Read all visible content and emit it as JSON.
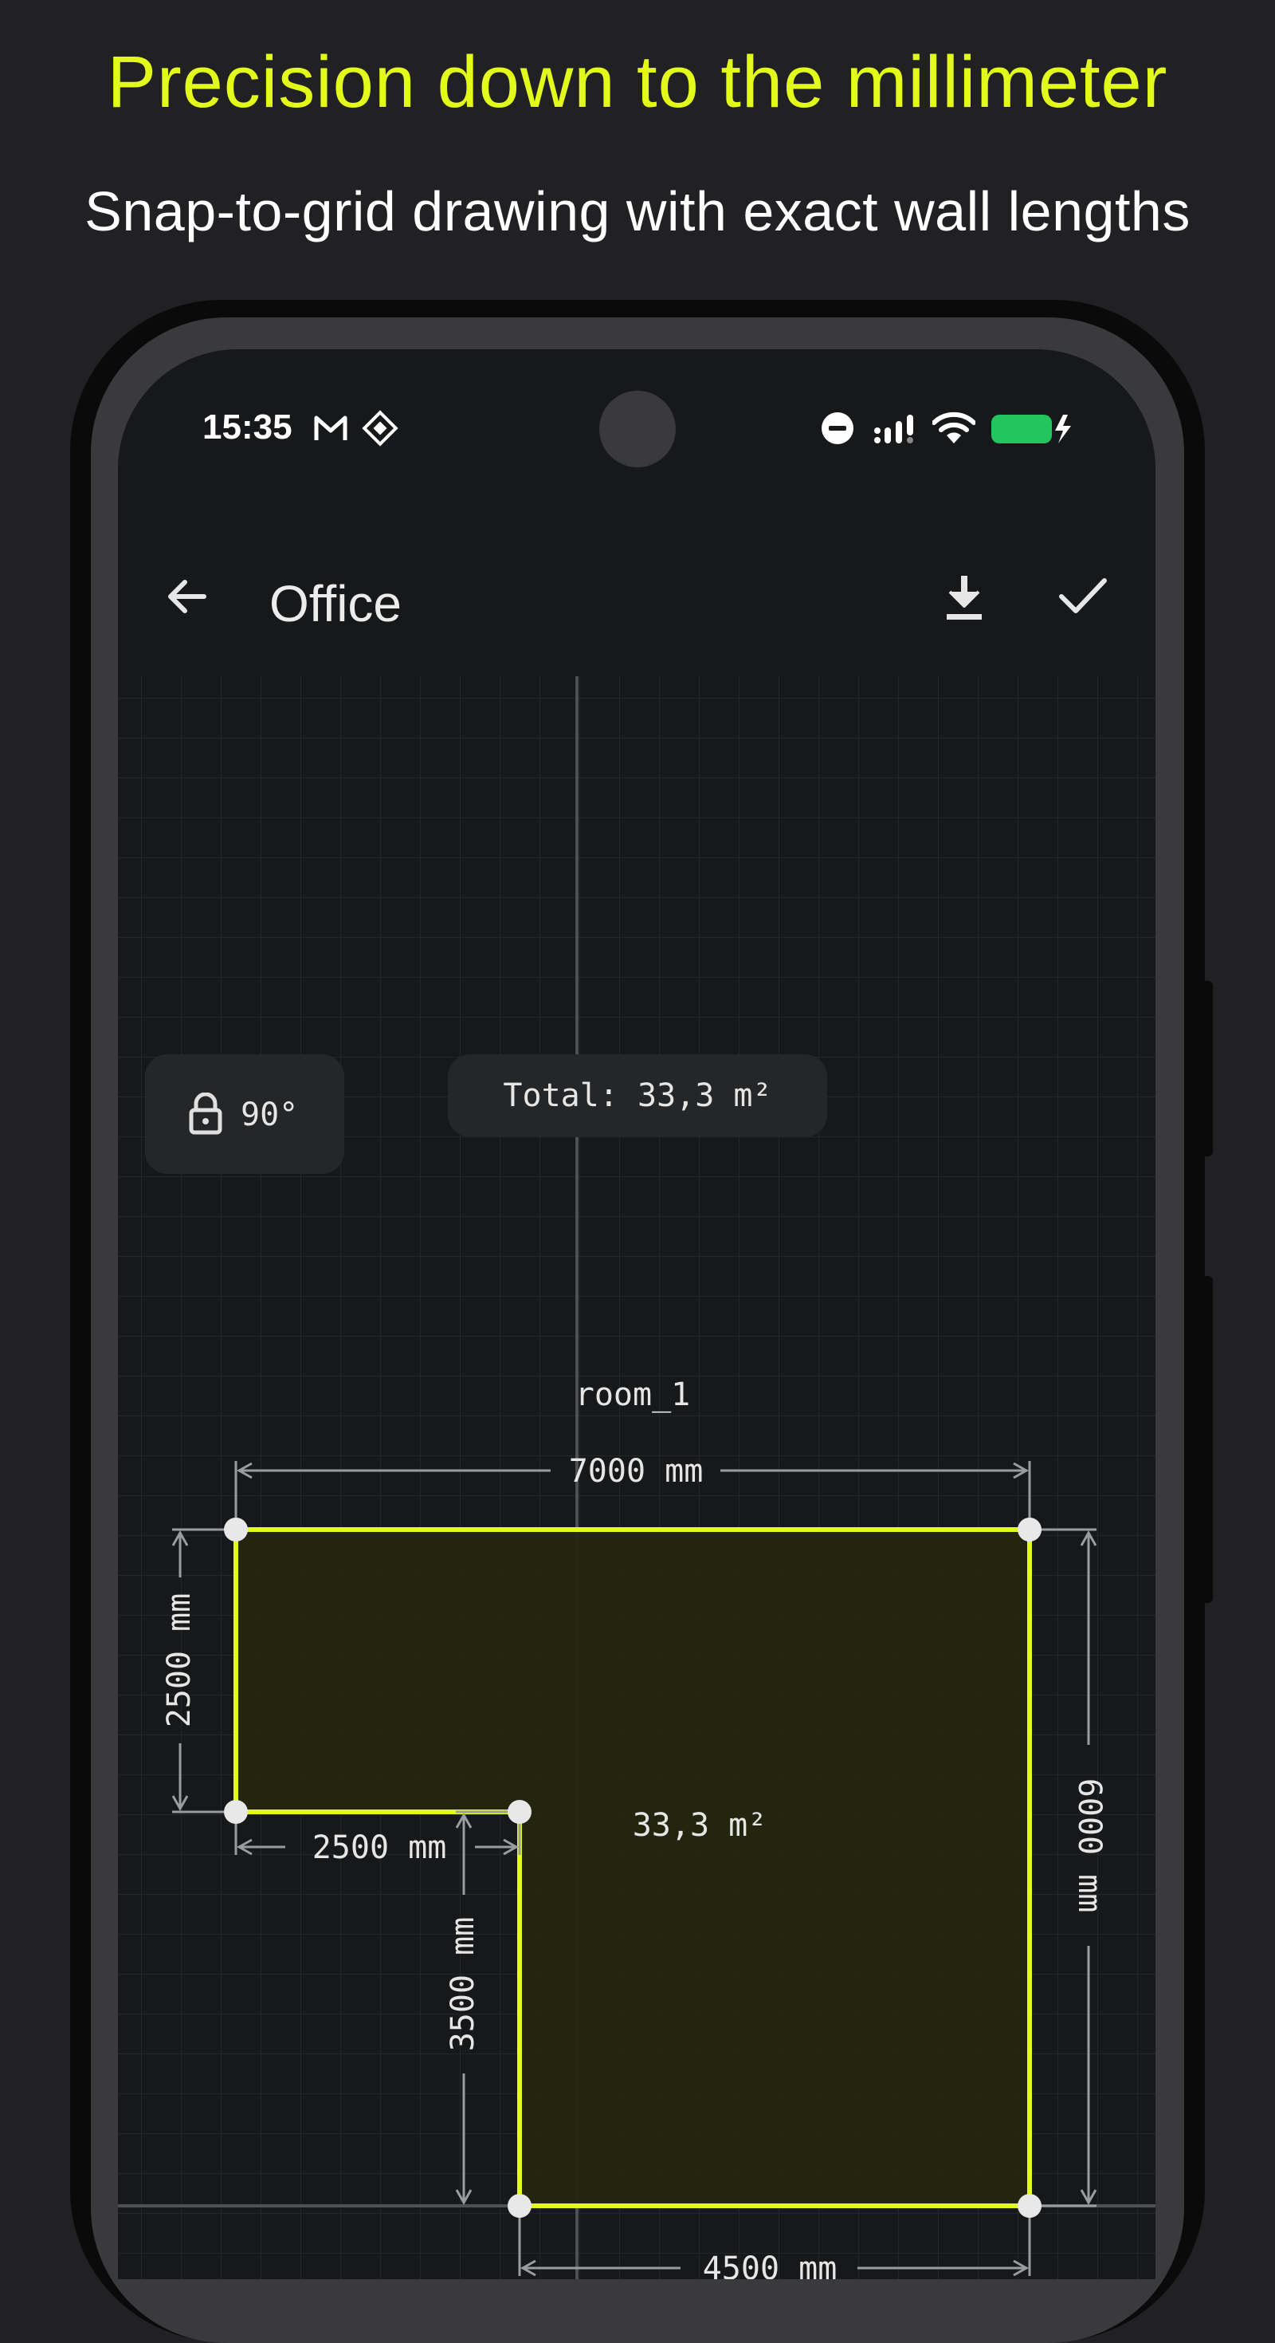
{
  "promo": {
    "headline": "Precision down to the millimeter",
    "subhead": "Snap-to-grid drawing with exact wall lengths"
  },
  "status_bar": {
    "time": "15:35",
    "left_icons": [
      "gmail-icon",
      "app-notification-icon"
    ],
    "right_icons": [
      "do-not-disturb-icon",
      "signal-icon",
      "wifi-icon",
      "battery-charging-icon"
    ],
    "battery_color": "#22c55e"
  },
  "app_bar": {
    "title": "Office",
    "back_icon": "arrow-left-icon",
    "actions": [
      "download-icon",
      "check-icon"
    ]
  },
  "toolbar": {
    "angle_lock_icon": "lock-icon",
    "angle_lock_label": "90°",
    "total_area_label": "Total: 33,3 m²"
  },
  "plan": {
    "room_name": "room_1",
    "room_area": "33,3 m²",
    "dimensions": {
      "top": "7000 mm",
      "left": "2500 mm",
      "inner_horizontal": "2500 mm",
      "inner_vertical": "3500 mm",
      "right": "6000 mm",
      "bottom": "4500 mm"
    },
    "accent_color": "#e3fb1a",
    "fill_color": "#24260f"
  }
}
